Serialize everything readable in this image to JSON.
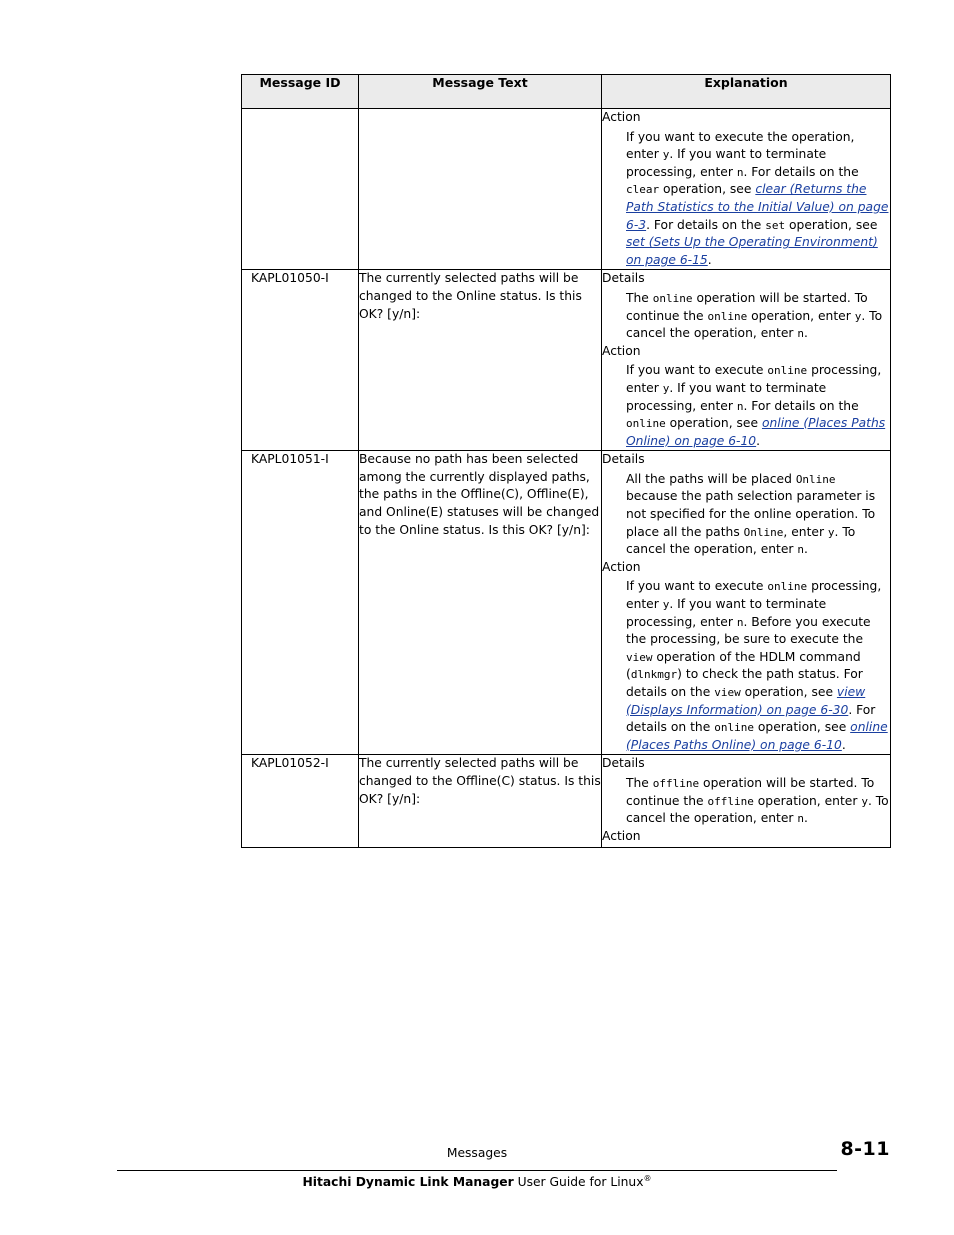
{
  "table": {
    "headers": [
      "Message ID",
      "Message Text",
      "Explanation"
    ],
    "rows": [
      {
        "id": "",
        "text": "",
        "explanation": {
          "blocks": [
            {
              "label": "Action",
              "body_html": "If you want to execute the operation, enter <code>y</code>. If you want to terminate processing, enter <code>n</code>. For details on the <code>clear</code> operation, see <span class=\"lnk\">clear (Returns the Path Statistics to the Initial Value) on page 6-3</span>. For details on the <code>set</code> operation, see <span class=\"lnk\">set (Sets Up the Operating Environment) on page 6-15</span>."
            }
          ]
        }
      },
      {
        "id": "KAPL01050-I",
        "text": "The currently selected paths will be changed to the Online status. Is this OK? [y/n]:",
        "explanation": {
          "blocks": [
            {
              "label": "Details",
              "body_html": "The <code>online</code> operation will be started. To continue the <code>online</code> operation, enter <code>y</code>. To cancel the operation, enter <code>n</code>."
            },
            {
              "label": "Action",
              "body_html": "If you want to execute <code>online</code> processing, enter <code>y</code>. If you want to terminate processing, enter <code>n</code>. For details on the <code>online</code> operation, see <span class=\"lnk\">online (Places Paths Online) on page 6-10</span>."
            }
          ]
        }
      },
      {
        "id": "KAPL01051-I",
        "text": "Because no path has been selected among the currently displayed paths, the paths in the Offline(C), Offline(E), and Online(E) statuses will be changed to the Online status. Is this OK? [y/n]:",
        "explanation": {
          "blocks": [
            {
              "label": "Details",
              "body_html": "All the paths will be placed <code>Online</code> because the path selection parameter is not specified for the online operation. To place all the paths <code>Online</code>, enter <code>y</code>. To cancel the operation, enter <code>n</code>."
            },
            {
              "label": "Action",
              "body_html": "If you want to execute <code>online</code> processing, enter <code>y</code>. If you want to terminate processing, enter <code>n</code>. Before you execute the processing, be sure to execute the <code>view</code> operation of the HDLM command (<code>dlnkmgr</code>) to check the path status. For details on the <code>view</code> operation, see <span class=\"lnk\">view (Displays Information) on page 6-30</span>. For details on the <code>online</code> operation, see <span class=\"lnk\">online (Places Paths Online) on page 6-10</span>."
            }
          ]
        }
      },
      {
        "id": "KAPL01052-I",
        "text": "The currently selected paths will be changed to the Offline(C) status. Is this OK? [y/n]:",
        "explanation": {
          "blocks": [
            {
              "label": "Details",
              "body_html": "The <code>offline</code> operation will be started. To continue the <code>offline</code> operation, enter <code>y</code>. To cancel the operation, enter <code>n</code>."
            },
            {
              "label": "Action",
              "body_html": ""
            }
          ]
        }
      }
    ]
  },
  "footer": {
    "section": "Messages",
    "page_number": "8-11",
    "doc_title_bold": "Hitachi Dynamic Link Manager",
    "doc_title_rest": " User Guide for Linux",
    "doc_title_sup": "®"
  }
}
